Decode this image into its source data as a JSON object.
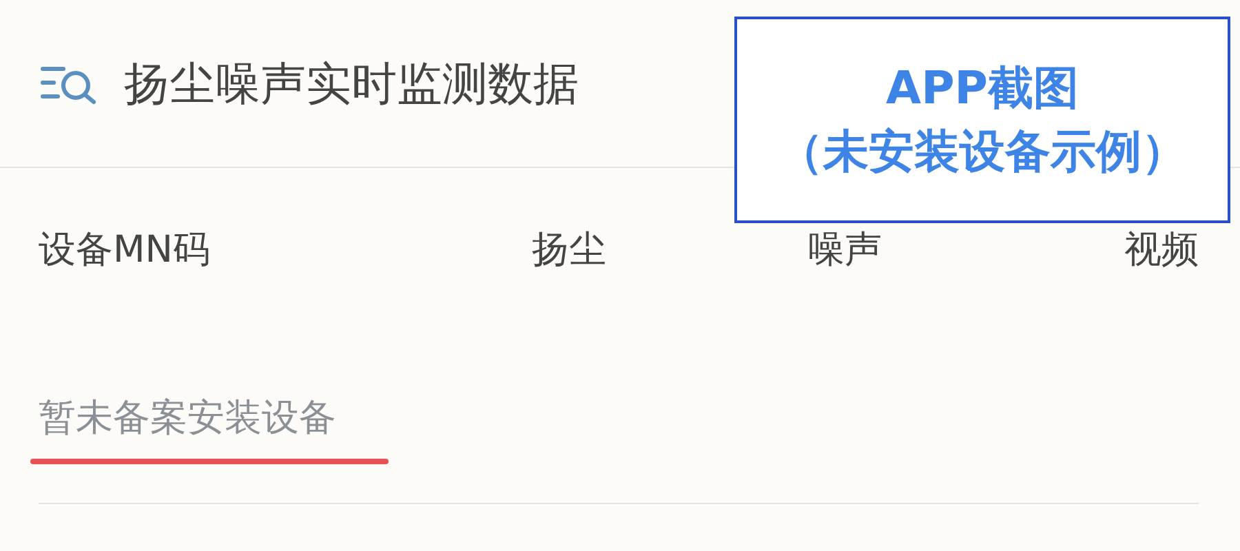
{
  "header": {
    "title": "扬尘噪声实时监测数据"
  },
  "table": {
    "columns": [
      "设备MN码",
      "扬尘",
      "噪声",
      "视频"
    ],
    "empty_message": "暂未备案安装设备"
  },
  "annotation": {
    "lines": [
      "APP截图",
      "（未安装设备示例）"
    ]
  }
}
